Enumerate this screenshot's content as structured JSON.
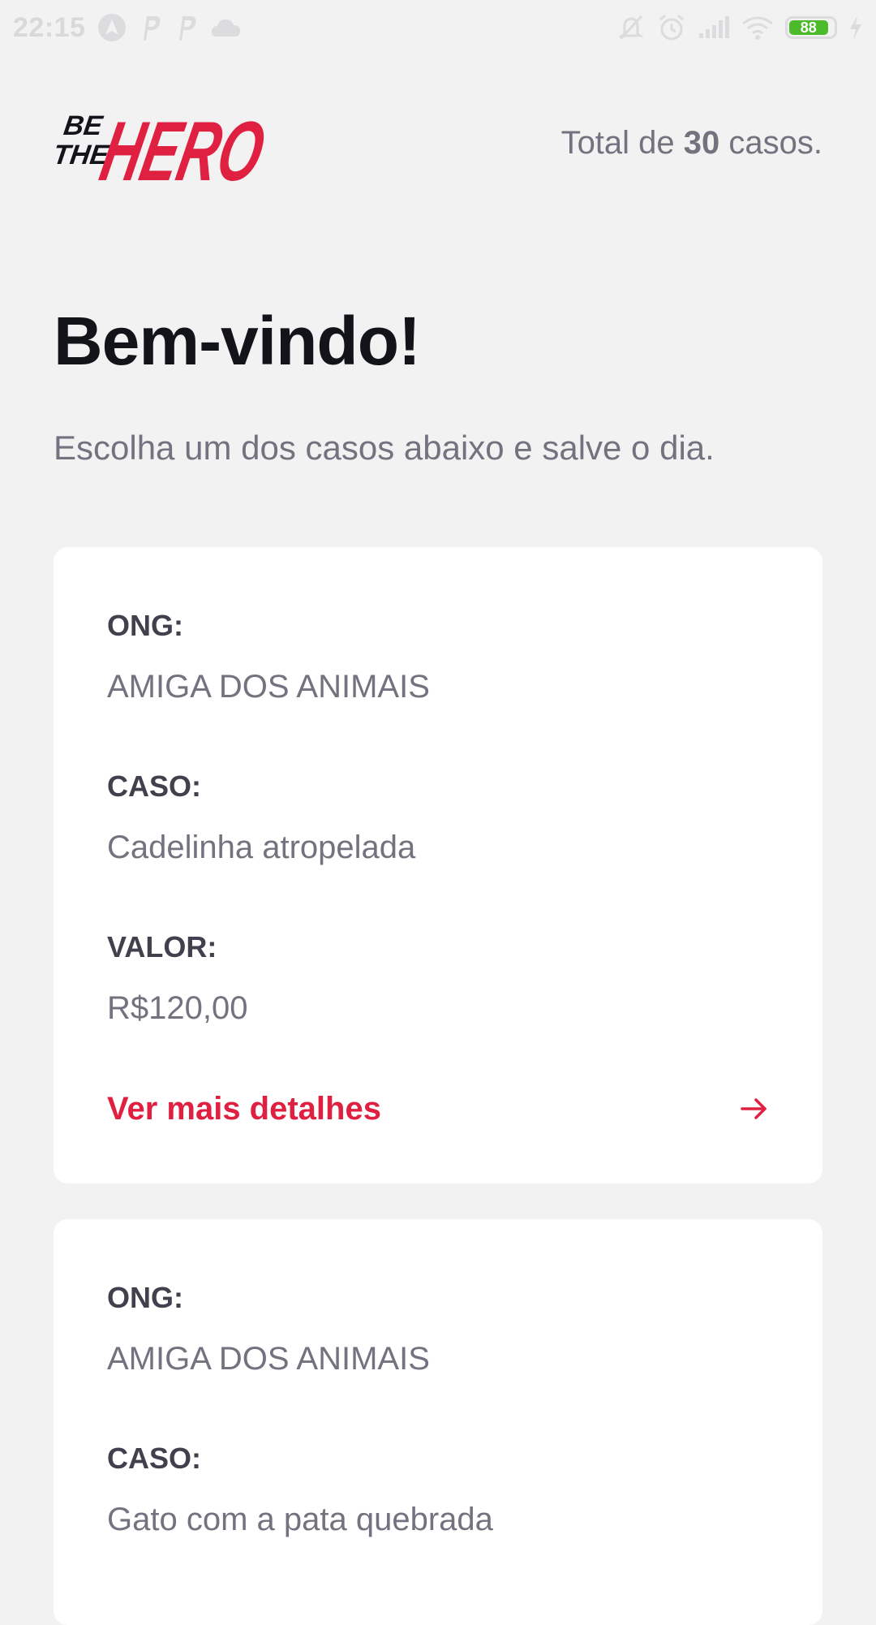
{
  "status_bar": {
    "time": "22:15",
    "battery_level": "88",
    "icons_left": [
      "navigation-icon",
      "parking-icon",
      "parking-icon",
      "cloud-icon"
    ],
    "icons_right": [
      "notifications-off-icon",
      "alarm-icon",
      "signal-icon",
      "wifi-icon",
      "battery-icon",
      "charging-icon"
    ]
  },
  "header": {
    "logo_top": "BE",
    "logo_mid": "THE",
    "logo_main": "HERO",
    "total_prefix": "Total de ",
    "total_count": "30",
    "total_suffix": " casos."
  },
  "main": {
    "title": "Bem-vindo!",
    "subtitle": "Escolha um dos casos abaixo e salve o dia."
  },
  "cases": [
    {
      "ong_label": "ONG:",
      "ong_value": "AMIGA DOS ANIMAIS",
      "caso_label": "CASO:",
      "caso_value": "Cadelinha atropelada",
      "valor_label": "VALOR:",
      "valor_value": "R$120,00",
      "details_label": "Ver mais detalhes"
    },
    {
      "ong_label": "ONG:",
      "ong_value": "AMIGA DOS ANIMAIS",
      "caso_label": "CASO:",
      "caso_value": "Gato com a pata quebrada"
    }
  ],
  "colors": {
    "brand_red": "#e02041",
    "background": "#f2f2f3",
    "text_dark": "#13131a",
    "text_muted": "#737380"
  }
}
